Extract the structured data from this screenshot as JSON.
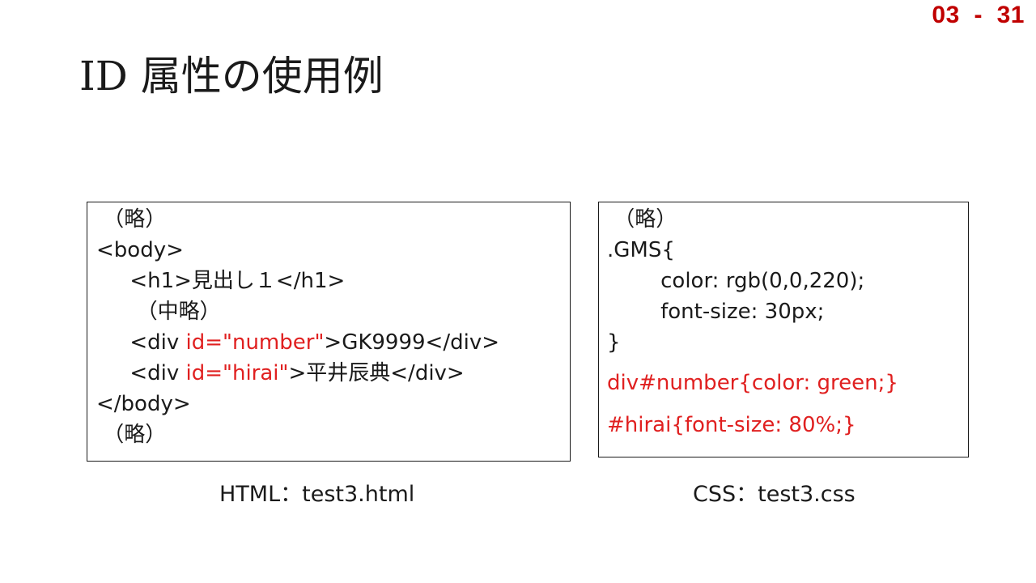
{
  "page_number": "03  -  31",
  "title": "ID 属性の使用例",
  "html_code": {
    "lines": [
      [
        {
          "text": " （略）",
          "red": false
        }
      ],
      [
        {
          "text": "<body>",
          "red": false
        }
      ],
      [
        {
          "text": "     <h1>見出し１</h1>",
          "red": false
        }
      ],
      [
        {
          "text": "      （中略）",
          "red": false
        }
      ],
      [
        {
          "text": "     <div ",
          "red": false
        },
        {
          "text": "id=\"number\"",
          "red": true
        },
        {
          "text": ">GK9999</div>",
          "red": false
        }
      ],
      [
        {
          "text": "     <div ",
          "red": false
        },
        {
          "text": "id=\"hirai\"",
          "red": true
        },
        {
          "text": ">平井辰典</div>",
          "red": false
        }
      ],
      [
        {
          "text": "</body>",
          "red": false
        }
      ],
      [
        {
          "text": " （略）",
          "red": false
        }
      ]
    ]
  },
  "css_code": {
    "lines": [
      {
        "segments": [
          {
            "text": " （略）",
            "red": false
          }
        ],
        "gap": false
      },
      {
        "segments": [
          {
            "text": ".GMS{",
            "red": false
          }
        ],
        "gap": false
      },
      {
        "segments": [
          {
            "text": "        color: rgb(0,0,220);",
            "red": false
          }
        ],
        "gap": false
      },
      {
        "segments": [
          {
            "text": "        font-size: 30px;",
            "red": false
          }
        ],
        "gap": false
      },
      {
        "segments": [
          {
            "text": "}",
            "red": false
          }
        ],
        "gap": false
      },
      {
        "segments": [
          {
            "text": "div#number{color: green;}",
            "red": true
          }
        ],
        "gap": true
      },
      {
        "segments": [
          {
            "text": "#hirai{font-size: 80%;}",
            "red": true
          }
        ],
        "gap": true
      }
    ]
  },
  "html_caption": "HTML：test3.html",
  "css_caption": "CSS：test3.css",
  "colors": {
    "accent_red": "#c00000",
    "code_red": "#e02020"
  }
}
